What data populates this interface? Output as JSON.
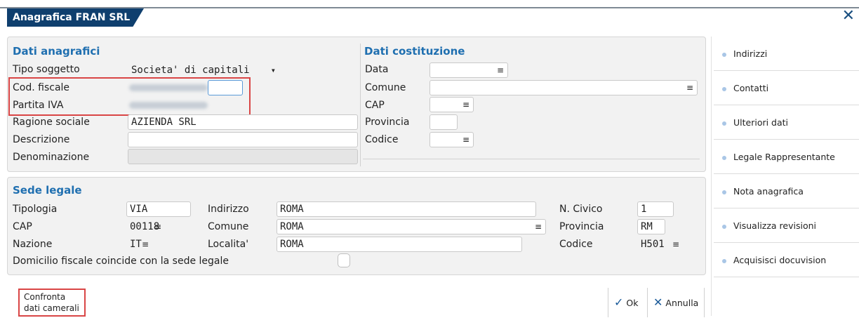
{
  "window": {
    "title": "Anagrafica FRAN SRL",
    "close_glyph": "✕"
  },
  "dati_anagrafici": {
    "title": "Dati anagrafici",
    "tipo_soggetto": {
      "label": "Tipo soggetto",
      "value": "Societa' di capitali"
    },
    "cod_fiscale": {
      "label": "Cod. fiscale"
    },
    "partita_iva": {
      "label": "Partita IVA"
    },
    "ragione_sociale": {
      "label": "Ragione sociale",
      "value": "AZIENDA SRL"
    },
    "descrizione": {
      "label": "Descrizione",
      "value": ""
    },
    "denominazione": {
      "label": "Denominazione",
      "value": ""
    }
  },
  "dati_costituzione": {
    "title": "Dati costituzione",
    "data": {
      "label": "Data"
    },
    "comune": {
      "label": "Comune"
    },
    "cap": {
      "label": "CAP"
    },
    "provincia": {
      "label": "Provincia"
    },
    "codice": {
      "label": "Codice"
    }
  },
  "sede_legale": {
    "title": "Sede legale",
    "tipologia": {
      "label": "Tipologia",
      "value": "VIA"
    },
    "indirizzo": {
      "label": "Indirizzo",
      "value": "ROMA"
    },
    "n_civico": {
      "label": "N. Civico",
      "value": "1"
    },
    "cap": {
      "label": "CAP",
      "value": "00118"
    },
    "comune": {
      "label": "Comune",
      "value": "ROMA"
    },
    "provincia": {
      "label": "Provincia",
      "value": "RM"
    },
    "nazione": {
      "label": "Nazione",
      "value": "IT"
    },
    "localita": {
      "label": "Localita'",
      "value": "ROMA"
    },
    "codice": {
      "label": "Codice",
      "value": "H501"
    },
    "domicilio_label": "Domicilio fiscale coincide con la sede legale"
  },
  "sidebar": {
    "items": [
      {
        "label": "Indirizzi"
      },
      {
        "label": "Contatti"
      },
      {
        "label": "Ulteriori dati"
      },
      {
        "label": "Legale Rappresentante"
      },
      {
        "label": "Nota anagrafica"
      },
      {
        "label": "Visualizza revisioni"
      },
      {
        "label": "Acquisisci docuvision"
      }
    ]
  },
  "footer": {
    "confronta_line1": "Confronta",
    "confronta_line2": "dati camerali",
    "ok_label": "Ok",
    "annulla_label": "Annulla"
  },
  "icons": {
    "menu": "≡",
    "dropdown": "▾",
    "check": "✓",
    "cross": "✕"
  },
  "colors": {
    "title_bar": "#0f3f6e",
    "section_title": "#1f6fb0",
    "highlight": "#d94545"
  }
}
